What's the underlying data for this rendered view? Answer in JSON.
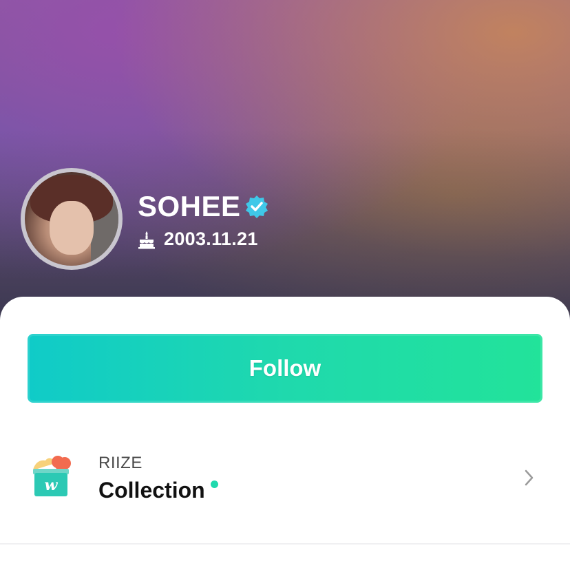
{
  "profile": {
    "name": "SOHEE",
    "birthday": "2003.11.21",
    "verified_icon": "verified-badge-icon",
    "birthday_icon": "cake-icon"
  },
  "actions": {
    "follow_label": "Follow"
  },
  "collection": {
    "group": "RIIZE",
    "title": "Collection",
    "icon": "weverse-collection-icon",
    "chevron_icon": "chevron-right-icon"
  },
  "colors": {
    "accent": "#1fd9ad",
    "follow_gradient_start": "#10cbc8",
    "follow_gradient_end": "#22e39a",
    "verified_badge": "#3fc8e8"
  }
}
